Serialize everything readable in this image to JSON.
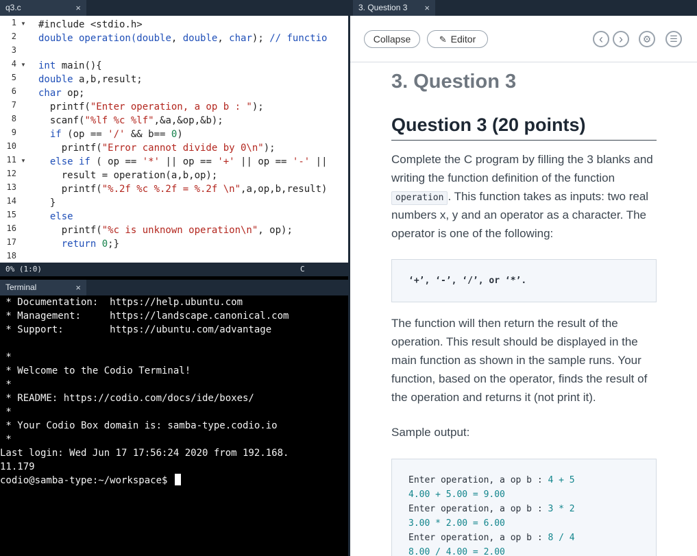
{
  "editor": {
    "tab_label": "q3.c",
    "tab_close": "×",
    "line_numbers": [
      "1",
      "2",
      "3",
      "4",
      "5",
      "6",
      "7",
      "8",
      "9",
      "10",
      "11",
      "12",
      "13",
      "14",
      "15",
      "16",
      "17",
      "18"
    ],
    "lines": {
      "l1": "#include <stdio.h>",
      "l2_type1": "double",
      "l2_name": " operation(",
      "l2_a1": "double",
      "l2_c1": ", ",
      "l2_a2": "double",
      "l2_c2": ", ",
      "l2_a3": "char",
      "l2_end": "); ",
      "l2_comment": "// functio",
      "l4_kw": "int",
      "l4_rest": " main(){",
      "l5_kw": "double",
      "l5_rest": " a,b,result;",
      "l6_kw": "char",
      "l6_rest": " op;",
      "l7_a": "  printf(",
      "l7_s": "\"Enter operation, a op b : \"",
      "l7_b": ");",
      "l8_a": "  scanf(",
      "l8_s": "\"%lf %c %lf\"",
      "l8_b": ",&a,&op,&b);",
      "l9_kw": "  if",
      "l9_a": " (op == ",
      "l9_s": "'/'",
      "l9_b": " && b== ",
      "l9_n": "0",
      "l9_c": ")",
      "l10_a": "    printf(",
      "l10_s": "\"Error cannot divide by 0\\n\"",
      "l10_b": ");",
      "l11_kw1": "  else",
      "l11_kw2": " if",
      "l11_a": " ( op == ",
      "l11_s1": "'*'",
      "l11_b": " || op == ",
      "l11_s2": "'+'",
      "l11_c": " || op == ",
      "l11_s3": "'-'",
      "l11_d": " ||",
      "l12": "    result = operation(a,b,op);",
      "l13_a": "    printf(",
      "l13_s": "\"%.2f %c %.2f = %.2f \\n\"",
      "l13_b": ",a,op,b,result)",
      "l14": "  }",
      "l15_kw": "  else",
      "l16_a": "    printf(",
      "l16_s": "\"%c is unknown operation\\n\"",
      "l16_b": ", op);",
      "l17_kw": "    return",
      "l17_a": " ",
      "l17_n": "0",
      "l17_b": ";}"
    }
  },
  "status": {
    "position": "0% (1:0)",
    "language": "C"
  },
  "terminal": {
    "tab_label": "Terminal",
    "tab_close": "×",
    "lines": [
      " * Documentation:  https://help.ubuntu.com",
      " * Management:     https://landscape.canonical.com",
      " * Support:        https://ubuntu.com/advantage",
      "",
      " *",
      " * Welcome to the Codio Terminal!",
      " *",
      " * README: https://codio.com/docs/ide/boxes/",
      " *",
      " * Your Codio Box domain is: samba-type.codio.io",
      " *",
      "Last login: Wed Jun 17 17:56:24 2020 from 192.168.",
      "11.179"
    ],
    "prompt": "codio@samba-type:~/workspace$ "
  },
  "guide": {
    "tab_label": "3. Question 3",
    "tab_close": "×",
    "collapse_label": "Collapse",
    "editor_label": "Editor",
    "prev_label": "‹",
    "next_label": "›",
    "settings_label": "⚙",
    "menu_label": "☰",
    "page_heading": "3. Question 3",
    "question_heading": "Question 3 (20 points)",
    "p1_before": "Complete the C program by filling the 3 blanks and writing the function definition of the function",
    "p1_code": "operation",
    "p1_after": ". This function takes as inputs: two real numbers x, y and an operator as a character. The operator is one of the following:",
    "operators": "‘+’, ‘-’, ‘/’, or ‘*’.",
    "p2": "The function will then return the result of the operation. This result should be displayed in the main function as shown in the sample runs. Your function, based on the operator, finds the result of the operation and returns it (not print it).",
    "sample_label": "Sample output:",
    "sample": [
      {
        "prompt": "Enter operation, a op b : ",
        "input": "4 + 5",
        "result": "4.00 + 5.00 = 9.00"
      },
      {
        "prompt": "Enter operation, a op b : ",
        "input": "3 * 2",
        "result": "3.00 * 2.00 = 6.00"
      },
      {
        "prompt": "Enter operation, a op b : ",
        "input": "8 / 4",
        "result": "8.00 / 4.00 = 2.00"
      }
    ]
  },
  "colors": {
    "tab_bar": "#1e2a38",
    "keyword": "#1f4fb8",
    "string": "#b3261e",
    "number": "#14804a",
    "terminal_bg": "#000000"
  }
}
